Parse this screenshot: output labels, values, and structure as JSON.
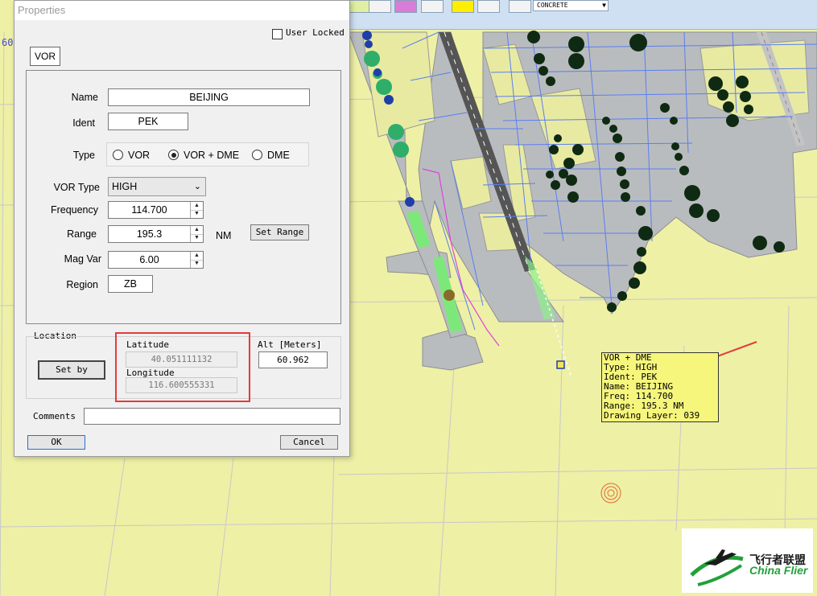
{
  "dialog": {
    "title": "Properties",
    "user_locked_label": "User Locked",
    "tab_label": "VOR",
    "name_label": "Name",
    "name_value": "BEIJING",
    "ident_label": "Ident",
    "ident_value": "PEK",
    "type_label": "Type",
    "type_options": [
      "VOR",
      "VOR + DME",
      "DME"
    ],
    "type_selected": "VOR + DME",
    "vor_type_label": "VOR Type",
    "vor_type_value": "HIGH",
    "frequency_label": "Frequency",
    "frequency_value": "114.700",
    "range_label": "Range",
    "range_value": "195.3",
    "range_unit": "NM",
    "set_range_label": "Set Range",
    "magvar_label": "Mag Var",
    "magvar_value": "6.00",
    "region_label": "Region",
    "region_value": "ZB",
    "location_label": "Location",
    "set_by_label": "Set by",
    "latitude_label": "Latitude",
    "latitude_value": "40.051111132",
    "longitude_label": "Longitude",
    "longitude_value": "116.600555331",
    "alt_label": "Alt [Meters]",
    "alt_value": "60.962",
    "comments_label": "Comments",
    "comments_value": "",
    "ok_label": "OK",
    "cancel_label": "Cancel"
  },
  "toolbar": {
    "surface_combo_value": "CONCRETE"
  },
  "map": {
    "coord_hint": "60",
    "tooltip": [
      "VOR + DME",
      "Type: HIGH",
      "Ident: PEK",
      "Name: BEIJING",
      "Freq: 114.700",
      "Range: 195.3 NM",
      "Drawing Layer: 039"
    ]
  },
  "watermark": {
    "cn_text": "飞行者联盟",
    "en_text": "China Flier"
  },
  "colors": {
    "map_bg": "#eef0a6",
    "tarmac": "#b9bcbf",
    "runway": "#555555",
    "grid_blue": "#5a7ef0",
    "highlight_red": "#e23c3c",
    "tooltip_bg": "#f6f67c"
  }
}
